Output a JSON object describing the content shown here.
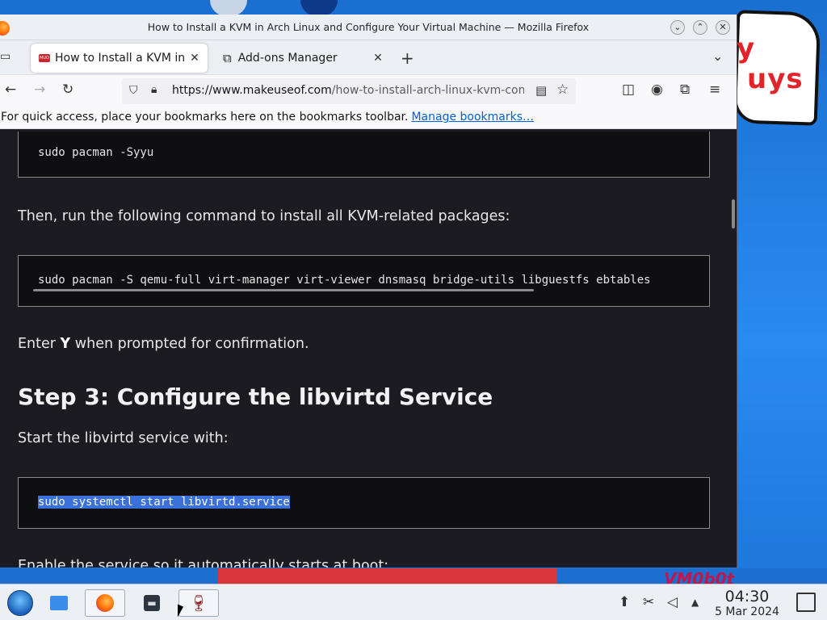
{
  "window": {
    "title": "How to Install a KVM in Arch Linux and Configure Your Virtual Machine — Mozilla Firefox"
  },
  "tabs": [
    {
      "label": "How to Install a KVM in Arch",
      "favicon": "muo-icon",
      "active": true
    },
    {
      "label": "Add-ons Manager",
      "favicon": "puzzle-icon",
      "active": false
    }
  ],
  "navbar": {
    "url_domain": "https://www.makeuseof.com",
    "url_path": "/how-to-install-arch-linux-kvm-con"
  },
  "bookmarks_bar": {
    "message": "For quick access, place your bookmarks here on the bookmarks toolbar.",
    "link": "Manage bookmarks…"
  },
  "article": {
    "code1": "sudo pacman -Syyu",
    "para1": "Then, run the following command to install all KVM-related packages:",
    "code2": "sudo pacman -S qemu-full virt-manager virt-viewer dnsmasq bridge-utils libguestfs ebtables",
    "para2_pre": "Enter ",
    "para2_bold": "Y",
    "para2_post": " when prompted for confirmation.",
    "heading": "Step 3: Configure the libvirtd Service",
    "para3": "Start the libvirtd service with:",
    "code3": "sudo systemctl start libvirtd.service",
    "para4_partial": "Enable the service so it automatically starts at boot:"
  },
  "desktop": {
    "sign_text_top": "y",
    "sign_text": "uys",
    "vm_tag": "VM0b0t"
  },
  "taskbar": {
    "time": "04:30",
    "date": "5 Mar 2024"
  }
}
